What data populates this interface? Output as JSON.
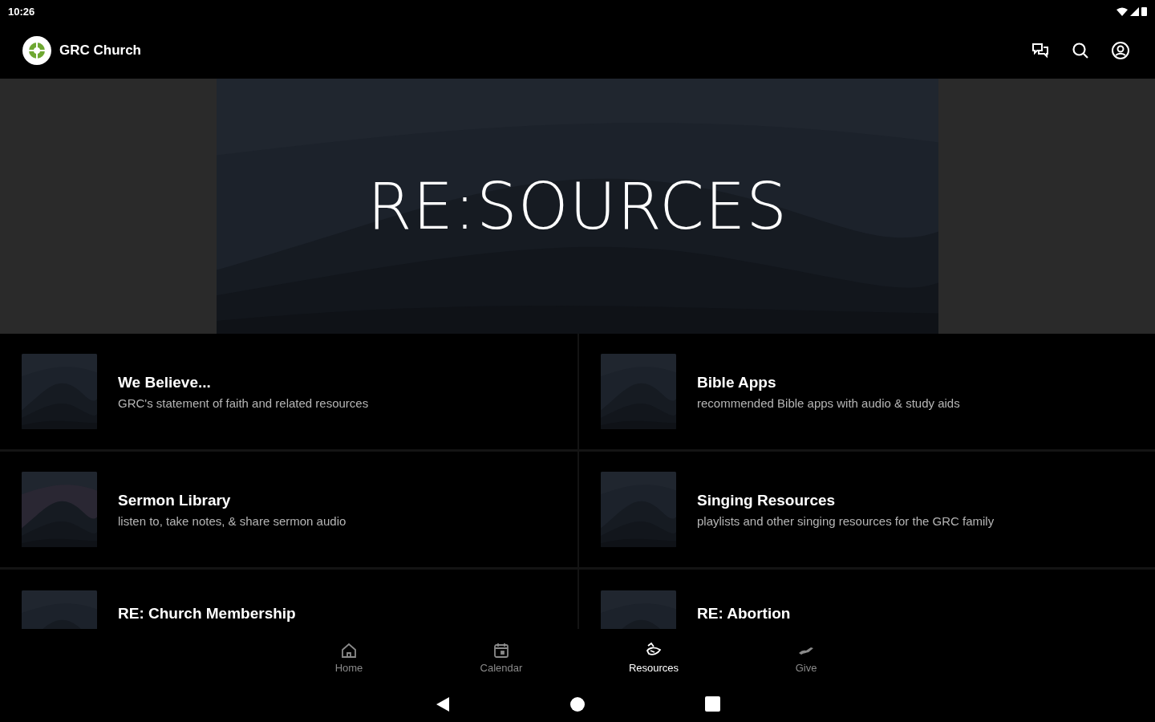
{
  "status_bar": {
    "time": "10:26"
  },
  "app_bar": {
    "title": "GRC Church"
  },
  "banner": {
    "title": "RE:SOURCES"
  },
  "resources": [
    {
      "title": "We Believe...",
      "subtitle": "GRC's statement of faith and related resources"
    },
    {
      "title": "Bible Apps",
      "subtitle": "recommended Bible apps with audio & study aids"
    },
    {
      "title": "Sermon Library",
      "subtitle": "listen to, take notes, & share sermon audio"
    },
    {
      "title": "Singing Resources",
      "subtitle": "playlists and other singing resources for the GRC family"
    },
    {
      "title": "RE: Church Membership"
    },
    {
      "title": "RE: Abortion"
    }
  ],
  "bottom_nav": [
    {
      "kind": "home",
      "label": "Home",
      "selected": false
    },
    {
      "kind": "calendar",
      "label": "Calendar",
      "selected": false
    },
    {
      "kind": "resources",
      "label": "Resources",
      "selected": true
    },
    {
      "kind": "give",
      "label": "Give",
      "selected": false
    }
  ]
}
